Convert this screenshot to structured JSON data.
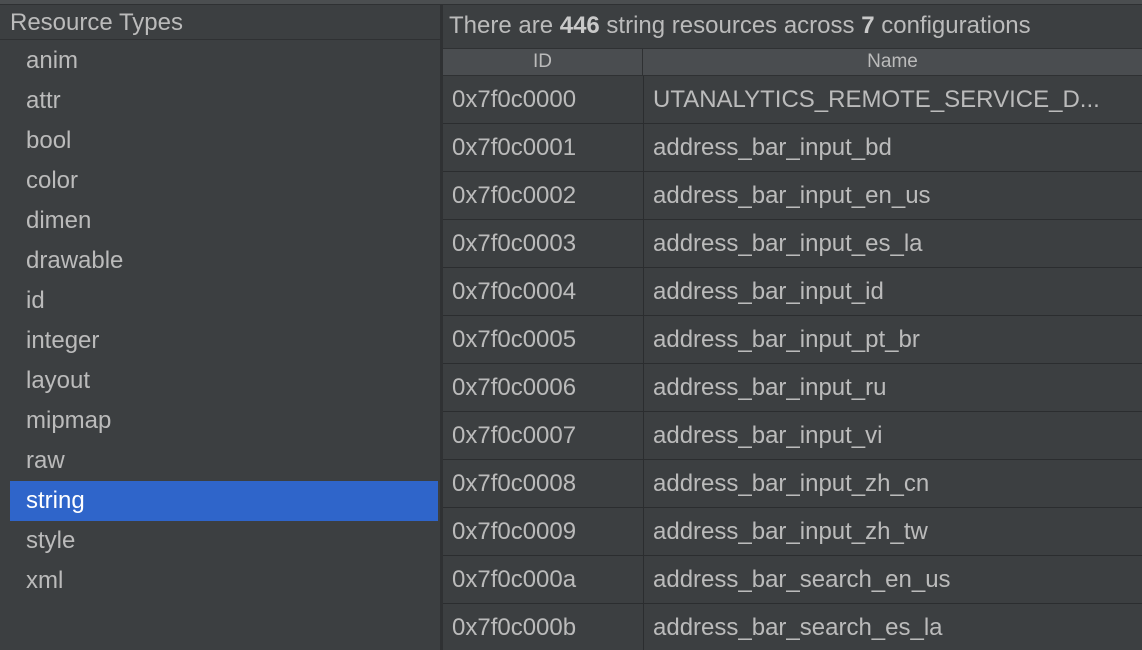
{
  "resource_panel": {
    "header": "Resource Types",
    "items": [
      "anim",
      "attr",
      "bool",
      "color",
      "dimen",
      "drawable",
      "id",
      "integer",
      "layout",
      "mipmap",
      "raw",
      "string",
      "style",
      "xml"
    ],
    "selected": "string"
  },
  "summary": {
    "prefix": "There are ",
    "count": "446",
    "middle": " string resources across ",
    "configs": "7",
    "suffix": " configurations"
  },
  "table": {
    "columns": [
      "ID",
      "Name"
    ],
    "rows": [
      {
        "id": "0x7f0c0000",
        "name": "UTANALYTICS_REMOTE_SERVICE_D..."
      },
      {
        "id": "0x7f0c0001",
        "name": "address_bar_input_bd"
      },
      {
        "id": "0x7f0c0002",
        "name": "address_bar_input_en_us"
      },
      {
        "id": "0x7f0c0003",
        "name": "address_bar_input_es_la"
      },
      {
        "id": "0x7f0c0004",
        "name": "address_bar_input_id"
      },
      {
        "id": "0x7f0c0005",
        "name": "address_bar_input_pt_br"
      },
      {
        "id": "0x7f0c0006",
        "name": "address_bar_input_ru"
      },
      {
        "id": "0x7f0c0007",
        "name": "address_bar_input_vi"
      },
      {
        "id": "0x7f0c0008",
        "name": "address_bar_input_zh_cn"
      },
      {
        "id": "0x7f0c0009",
        "name": "address_bar_input_zh_tw"
      },
      {
        "id": "0x7f0c000a",
        "name": "address_bar_search_en_us"
      },
      {
        "id": "0x7f0c000b",
        "name": "address_bar_search_es_la"
      }
    ]
  },
  "colors": {
    "background": "#3c3f41",
    "selection": "#2f65ca",
    "text": "#bbbbbb"
  }
}
